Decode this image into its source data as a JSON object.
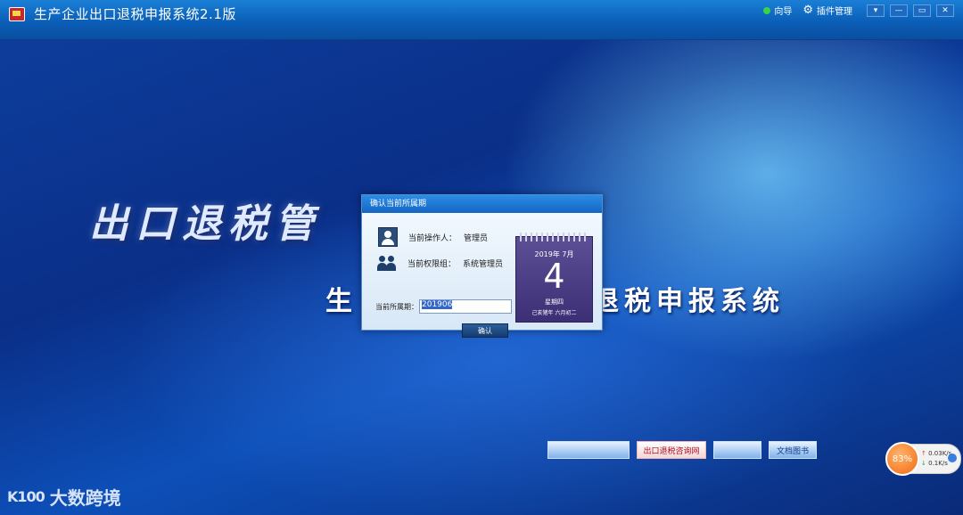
{
  "window": {
    "title": "生产企业出口退税申报系统2.1版",
    "guide_label": "向导",
    "plugin_label": "插件管理",
    "controls": [
      "▾",
      "—",
      "▭",
      "✕"
    ]
  },
  "background": {
    "big_text": "出口退税管",
    "sub_text_left": "生",
    "sub_text_right": "退税申报系统",
    "bottom_icons": [
      "",
      "出口退税咨询网",
      "",
      "文档图书"
    ]
  },
  "dialog": {
    "title": "确认当前所属期",
    "operator_label": "当前操作人：",
    "operator_value": "管理员",
    "group_label": "当前权限组：",
    "group_value": "系统管理员",
    "period_label": "当前所属期：",
    "period_value": "201906",
    "ok_label": "确认"
  },
  "calendar": {
    "year_month": "2019年  7月",
    "day": "4",
    "weekday": "星期四",
    "lunar": "己亥猪年  六月初二"
  },
  "speed_widget": {
    "percent": "83%",
    "up": "0.03K/s",
    "down": "0.1K/s"
  },
  "watermark": {
    "logo": "K100",
    "text": "大数跨境"
  }
}
